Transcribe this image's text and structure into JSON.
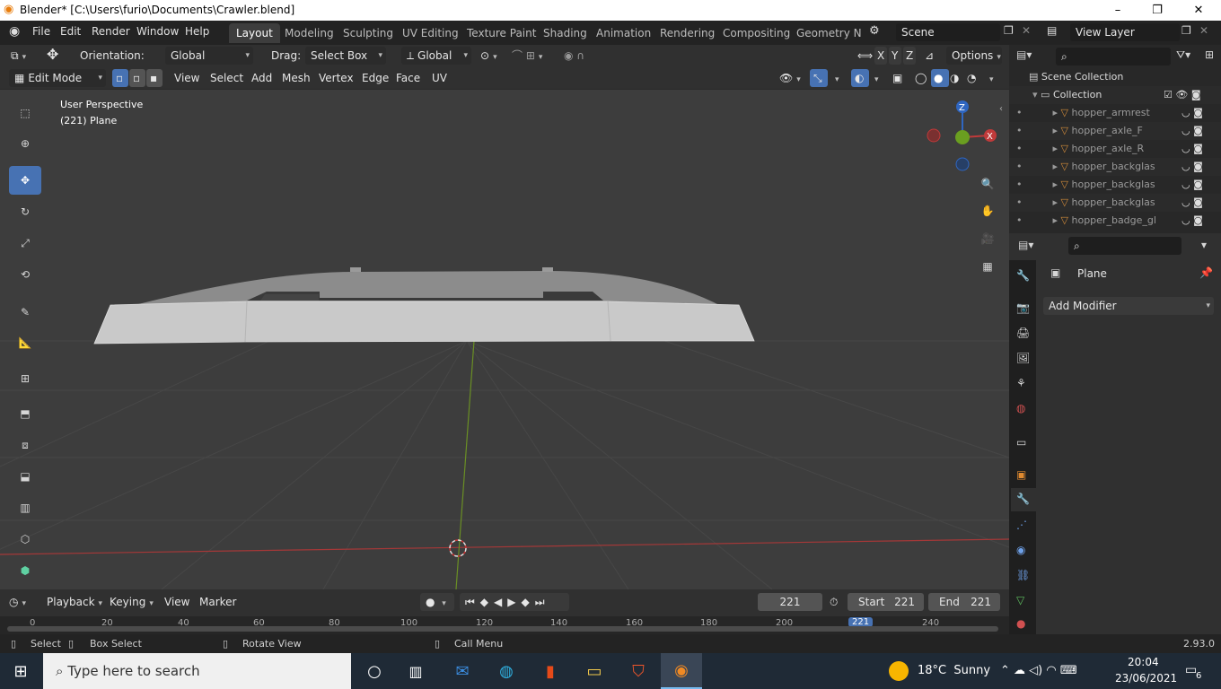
{
  "window": {
    "title": "Blender* [C:\\Users\\furio\\Documents\\Crawler.blend]",
    "minimize": "–",
    "maximize": "❐",
    "close": "✕"
  },
  "menu": {
    "items": [
      "File",
      "Edit",
      "Render",
      "Window",
      "Help"
    ],
    "workspaces": [
      "Layout",
      "Modeling",
      "Sculpting",
      "UV Editing",
      "Texture Paint",
      "Shading",
      "Animation",
      "Rendering",
      "Compositing",
      "Geometry No"
    ],
    "active_workspace": "Layout",
    "scene": "Scene",
    "view_layer": "View Layer"
  },
  "tool_header": {
    "orientation_label": "Orientation:",
    "orientation_value": "Global",
    "drag_label": "Drag:",
    "drag_value": "Select Box",
    "transform_orientation": "Global",
    "axes": [
      "X",
      "Y",
      "Z"
    ],
    "options": "Options"
  },
  "editor_header": {
    "mode": "Edit Mode",
    "menus": [
      "View",
      "Select",
      "Add",
      "Mesh",
      "Vertex",
      "Edge",
      "Face",
      "UV"
    ]
  },
  "viewport": {
    "perspective": "User Perspective",
    "object_info": "(221) Plane",
    "gizmo_axes": {
      "z": "Z",
      "x": "X"
    },
    "colors": {
      "background": "#3d3d3d",
      "grid": "#4a4a4a",
      "x_axis": "#b03a3a",
      "y_axis": "#6d8f2a",
      "mesh": "#c8c8c8"
    }
  },
  "outliner": {
    "scene_collection": "Scene Collection",
    "collection": "Collection",
    "objects": [
      "hopper_armrest",
      "hopper_axle_F",
      "hopper_axle_R",
      "hopper_backglas",
      "hopper_backglas",
      "hopper_backglas",
      "hopper_badge_gl"
    ]
  },
  "properties": {
    "object_name": "Plane",
    "add_modifier": "Add Modifier"
  },
  "timeline": {
    "menus": [
      "Playback",
      "Keying",
      "View",
      "Marker"
    ],
    "current_frame": "221",
    "start_label": "Start",
    "start": "221",
    "end_label": "End",
    "end": "221",
    "ruler": [
      "0",
      "20",
      "40",
      "60",
      "80",
      "100",
      "120",
      "140",
      "160",
      "180",
      "200",
      "221",
      "240"
    ]
  },
  "status": {
    "select": "Select",
    "box_select": "Box Select",
    "rotate_view": "Rotate View",
    "call_menu": "Call Menu",
    "version": "2.93.0"
  },
  "taskbar": {
    "search_placeholder": "Type here to search",
    "weather": "18°C  Sunny",
    "time": "20:04",
    "date": "23/06/2021",
    "notifications": "6"
  }
}
